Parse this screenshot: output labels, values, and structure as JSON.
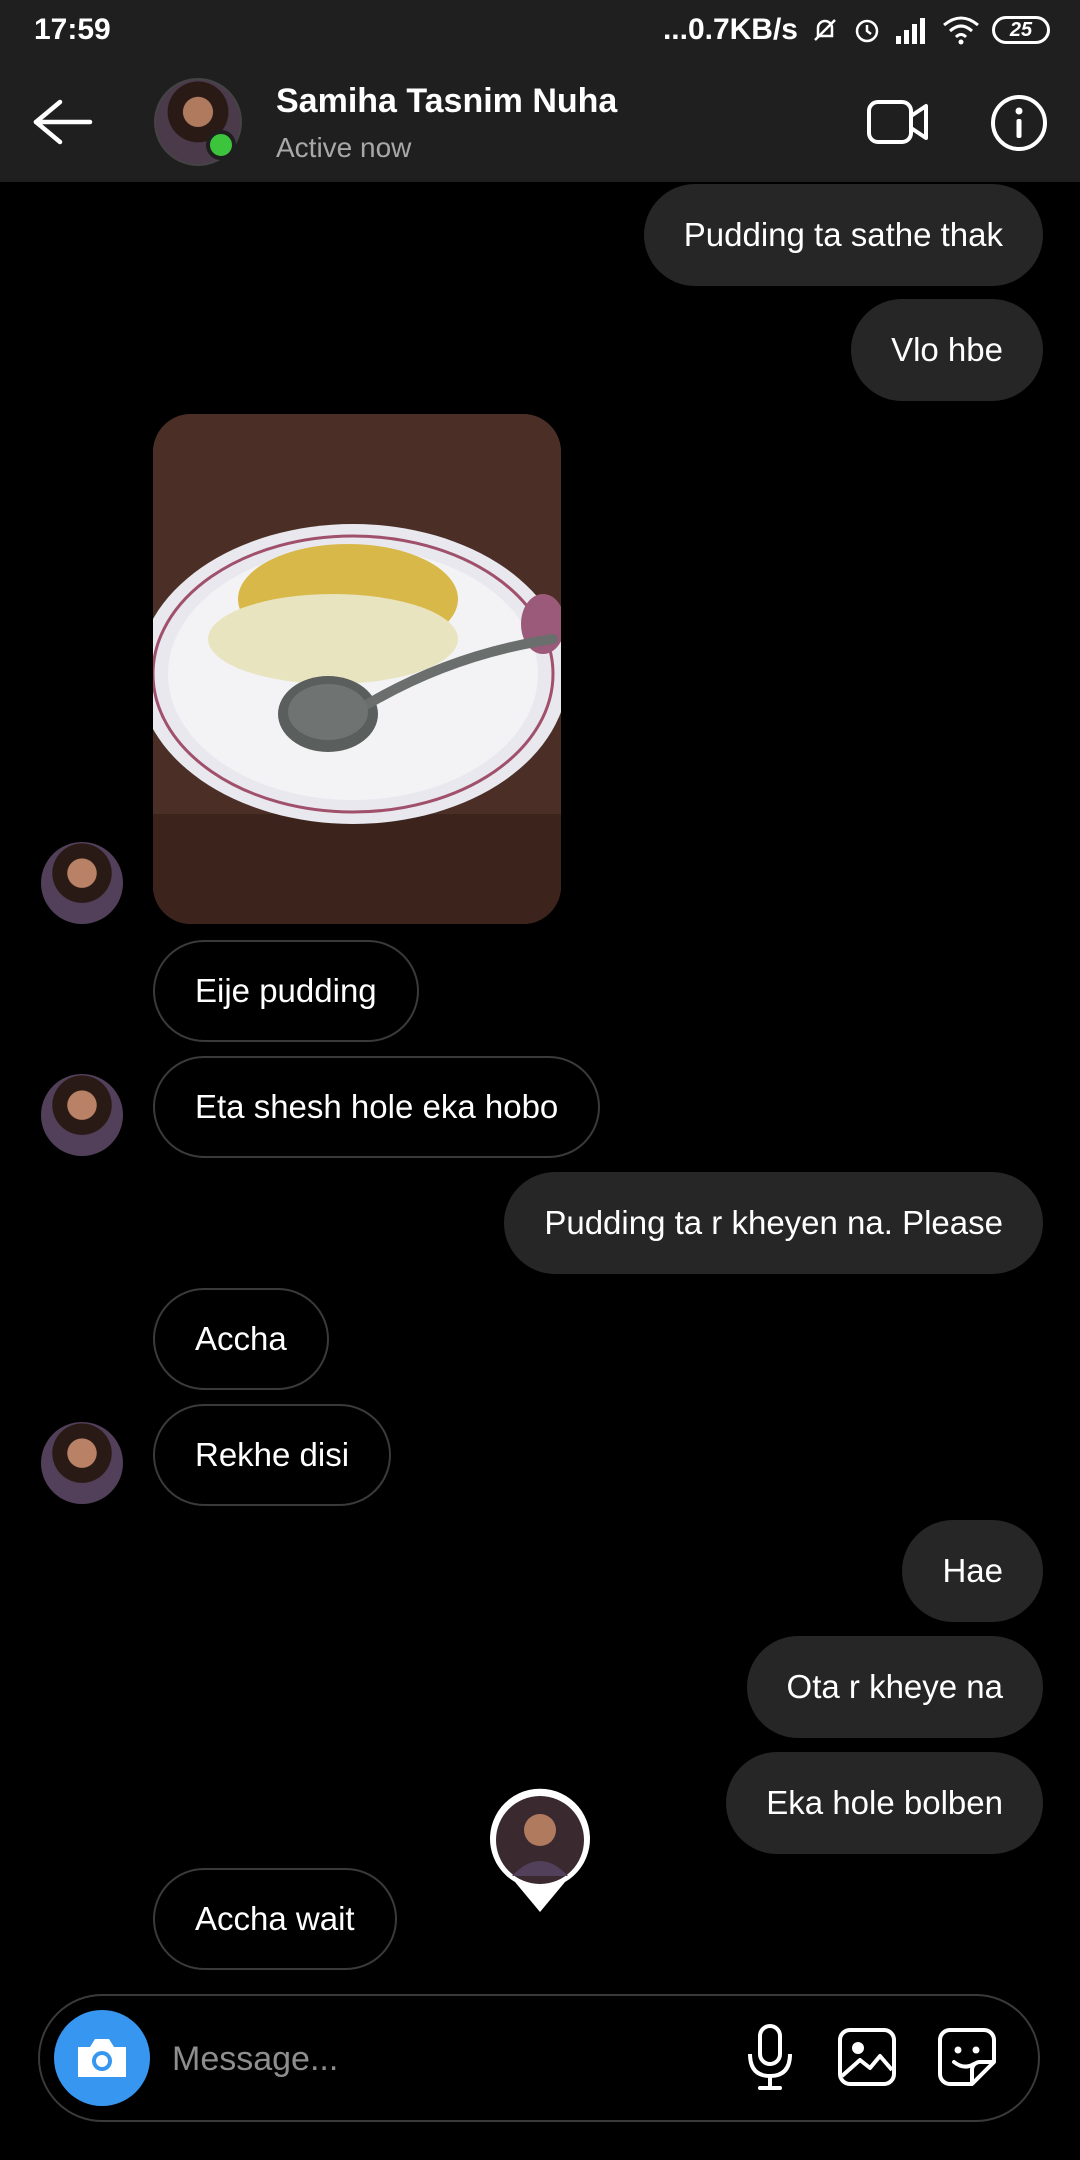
{
  "status_bar": {
    "time": "17:59",
    "network_speed": "...0.7KB/s",
    "battery": "25",
    "icons": [
      "mute-bell-icon",
      "alarm-icon",
      "signal-icon",
      "wifi-icon",
      "battery-icon"
    ]
  },
  "header": {
    "contact_name": "Samiha Tasnim Nuha",
    "status": "Active now",
    "online_color": "#3cc53c"
  },
  "messages": [
    {
      "direction": "sent",
      "text": "Pudding ta sathe thak"
    },
    {
      "direction": "sent",
      "text": "Vlo hbe"
    },
    {
      "direction": "received",
      "type": "photo",
      "description": "photo-pudding-on-plate"
    },
    {
      "direction": "received",
      "text": "Eije pudding"
    },
    {
      "direction": "received",
      "text": "Eta shesh hole eka hobo"
    },
    {
      "direction": "sent",
      "text": "Pudding ta r kheyen na. Please"
    },
    {
      "direction": "received",
      "text": "Accha"
    },
    {
      "direction": "received",
      "text": "Rekhe disi"
    },
    {
      "direction": "sent",
      "text": "Hae"
    },
    {
      "direction": "sent",
      "text": "Ota r kheye na"
    },
    {
      "direction": "sent",
      "text": "Eka hole bolben"
    },
    {
      "direction": "received",
      "text": "Accha wait"
    }
  ],
  "composer": {
    "placeholder": "Message...",
    "camera_color": "#3797f0"
  },
  "colors": {
    "background": "#000000",
    "bar": "#1f1f1f",
    "sent_bubble": "#262626",
    "received_border": "#3a3a3a"
  }
}
